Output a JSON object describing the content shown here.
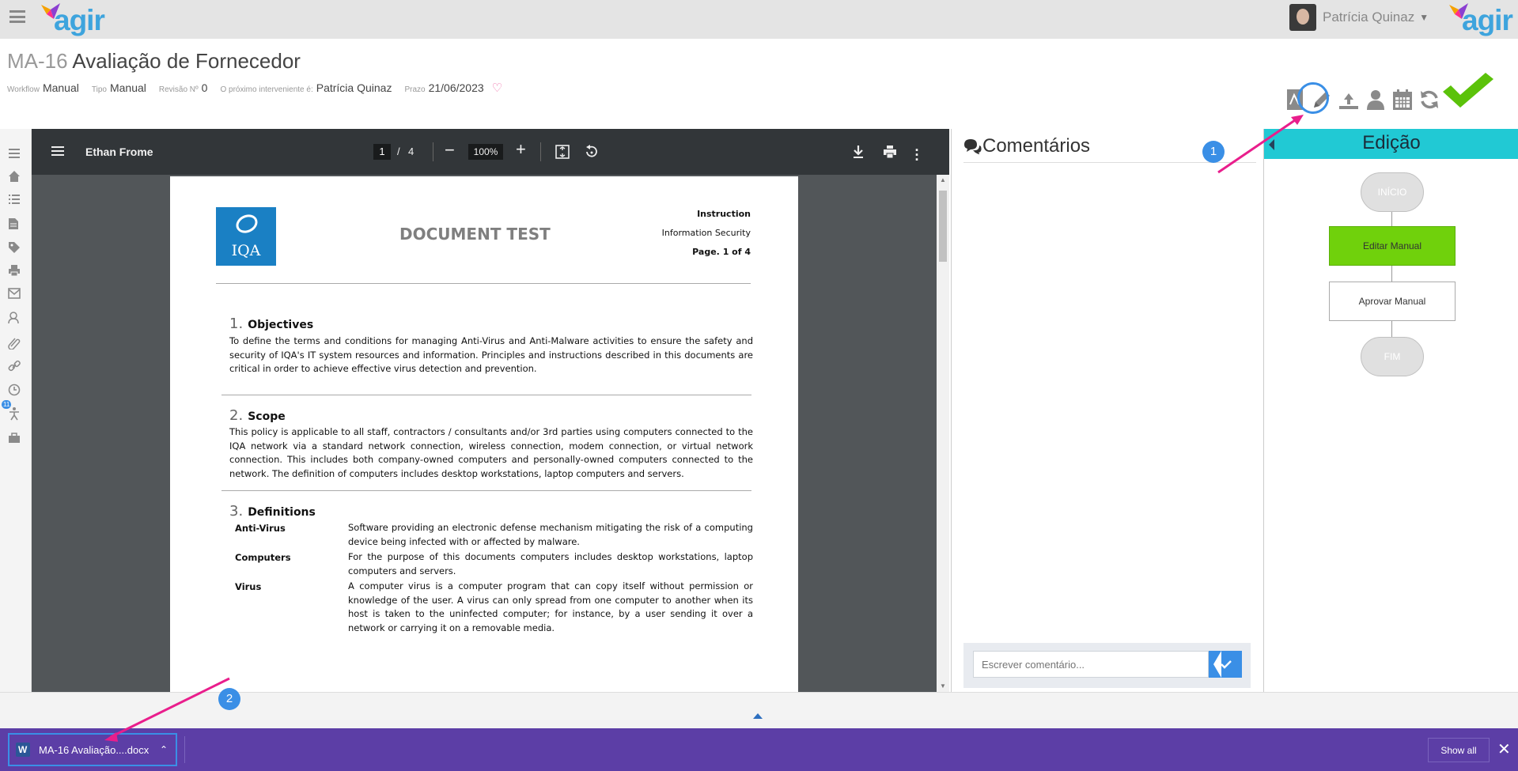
{
  "header": {
    "brand": "agir",
    "user_name": "Patrícia Quinaz",
    "title_code": "MA-16",
    "title_name": "Avaliação de Fornecedor"
  },
  "meta": {
    "workflow_label": "Workflow",
    "workflow_value": "Manual",
    "tipo_label": "Tipo",
    "tipo_value": "Manual",
    "revisao_label": "Revisão Nº",
    "revisao_value": "0",
    "interveniente_label": "O próximo interveniente é:",
    "interveniente_value": "Patrícia Quinaz",
    "prazo_label": "Prazo",
    "prazo_value": "21/06/2023"
  },
  "rail_badge": "11",
  "viewer": {
    "doc_name": "Ethan Frome",
    "page_current": "1",
    "page_sep": "/",
    "page_total": "4",
    "zoom": "100%"
  },
  "document": {
    "logo_text": "IQA",
    "heading": "DOCUMENT TEST",
    "hdr_line1": "Instruction",
    "hdr_line2": "Information Security",
    "hdr_line3": "Page. 1 of 4",
    "s1_num": "1.",
    "s1_title": "Objectives",
    "s1_text": "To define the terms and conditions for managing Anti-Virus and Anti-Malware activities to ensure the safety and security of IQA's IT system resources and information. Principles and instructions described in this documents are critical in order to achieve effective virus detection and prevention.",
    "s2_num": "2.",
    "s2_title": "Scope",
    "s2_text": "This policy is applicable to all staff, contractors / consultants and/or 3rd parties using computers connected to the IQA network via a standard network connection, wireless connection, modem connection, or virtual network connection. This includes both company-owned computers and personally-owned computers connected to the network. The definition of computers includes desktop workstations, laptop computers and servers.",
    "s3_num": "3.",
    "s3_title": "Definitions",
    "definitions": [
      {
        "term": "Anti-Virus",
        "text": "Software providing an electronic defense mechanism mitigating the risk of a computing device being infected with or affected by malware."
      },
      {
        "term": "Computers",
        "text": "For the purpose of this documents computers includes desktop workstations, laptop computers and servers."
      },
      {
        "term": "Virus",
        "text": "A computer virus is a computer program that can copy itself without permission or knowledge of the user. A virus can only spread from one computer to another when its host is taken to the uninfected computer; for instance, by a user sending it over a network or carrying it on a removable media."
      }
    ]
  },
  "comments": {
    "title": "Comentários",
    "placeholder": "Escrever comentário..."
  },
  "workflow": {
    "title": "Edição",
    "nodes": [
      "INÍCIO",
      "Editar Manual",
      "Aprovar Manual",
      "FIM"
    ]
  },
  "download": {
    "file_name": "MA-16 Avaliação....docx",
    "show_all": "Show all",
    "close": "✕"
  },
  "annotations": [
    "1",
    "2"
  ],
  "colors": {
    "brand_blue": "#3ea4dd",
    "annotation_blue": "#3a8fe6",
    "arrow_pink": "#e91e8c",
    "workflow_header": "#21c9d4",
    "active_step": "#70d10c",
    "download_bar": "#5c3ea6",
    "check_green": "#5bc20a"
  }
}
